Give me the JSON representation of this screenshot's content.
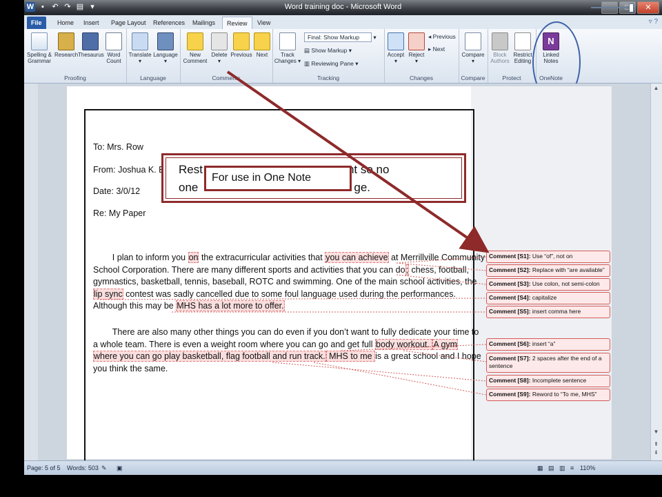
{
  "window": {
    "title": "Word training doc - Microsoft Word",
    "qat_icons": [
      "word-logo-icon",
      "save-icon",
      "undo-icon",
      "redo-icon",
      "print-preview-icon",
      "customize-qat-icon"
    ],
    "controls": [
      "minimize-icon",
      "maximize-icon",
      "close-icon"
    ]
  },
  "tabs": [
    {
      "label": "File"
    },
    {
      "label": "Home"
    },
    {
      "label": "Insert"
    },
    {
      "label": "Page Layout"
    },
    {
      "label": "References"
    },
    {
      "label": "Mailings"
    },
    {
      "label": "Review"
    },
    {
      "label": "View"
    }
  ],
  "ribbon": {
    "proofing": {
      "name": "Proofing",
      "spelling": "Spelling & Grammar",
      "spelling_l1": "Spelling &",
      "spelling_l2": "Grammar",
      "research": "Research",
      "thesaurus": "Thesaurus",
      "wordcount_l1": "Word",
      "wordcount_l2": "Count"
    },
    "language": {
      "name": "Language",
      "translate": "Translate",
      "language": "Language"
    },
    "comments": {
      "name": "Comments",
      "new_l1": "New",
      "new_l2": "Comment",
      "delete": "Delete",
      "previous": "Previous",
      "next": "Next"
    },
    "tracking": {
      "name": "Tracking",
      "track_l1": "Track",
      "track_l2": "Changes",
      "final_markup": "Final: Show Markup",
      "show_markup": "Show Markup",
      "reviewing_pane": "Reviewing Pane"
    },
    "changes": {
      "name": "Changes",
      "accept": "Accept",
      "reject": "Reject",
      "previous": "Previous",
      "next": "Next"
    },
    "compare": {
      "name": "Compare",
      "compare": "Compare"
    },
    "protect": {
      "name": "Protect",
      "block_l1": "Block",
      "block_l2": "Authors",
      "restrict_l1": "Restrict",
      "restrict_l2": "Editing"
    },
    "onenote": {
      "name": "OneNote",
      "linked_l1": "Linked",
      "linked_l2": "Notes"
    }
  },
  "document": {
    "to": "To:  Mrs. Row",
    "from": "From:  Joshua K. Brewer",
    "date": "Date:  3/0/12",
    "re": "Re:  My Paper",
    "p1": {
      "l1_a": "I plan to inform you ",
      "l1_b": "on",
      "l1_c": " the extracurricular activities that ",
      "l1_d": "you can achieve",
      "l1_e": " at Merrillville Community",
      "l2_a": "School Corporation.  There are many different sports and activities that you can do",
      "l2_b": ";",
      "l2_c": " chess, football,",
      "l3": "gymnastics, basketball, tennis, baseball, ROTC and swimming.  One of the main school activities, the",
      "l4_a": "lip sync",
      "l4_b": " contest was sadly cancelled due to some foul language used during the performances.",
      "l5_a": "Although this may be ",
      "l5_b": "MHS has a lot more to offer."
    },
    "p2": {
      "l1": "There are also many other things you can do even if you don’t want to fully dedicate your time to",
      "l2_a": "a whole team.  There is even a weight room where you can go and get full ",
      "l2_b": "body workout. ",
      "l2_c": "A gym",
      "l3_a": "where you can go play basketball, flag football and run track.",
      "l3_b": " MHS to me ",
      "l3_c": "is a great school and I hope",
      "l4": "you think the same."
    }
  },
  "comments": [
    {
      "label": "Comment [S1]:",
      "text": " Use “of”, not on"
    },
    {
      "label": "Comment [S2]:",
      "text": " Replace with “are available”"
    },
    {
      "label": "Comment [S3]:",
      "text": " Use colon, not semi-colon"
    },
    {
      "label": "Comment [S4]:",
      "text": " capitalize"
    },
    {
      "label": "Comment [S5]:",
      "text": " insert comma here"
    },
    {
      "label": "Comment [S6]:",
      "text": " insert “a”"
    },
    {
      "label": "Comment [S7]:",
      "text": " 2 spaces after the end of a sentence"
    },
    {
      "label": "Comment [S8]:",
      "text": " Incomplete sentence"
    },
    {
      "label": "Comment [S9]:",
      "text": " Reword to “To me, MHS”"
    }
  ],
  "overlay": {
    "restrict_text": "Restrict editing to a document so no one else can make a change.",
    "restrict_visible_a": "Rest",
    "restrict_visible_b": "nt so no",
    "restrict_visible_c": "one",
    "restrict_visible_d": "ge.",
    "callout": "For use in One Note",
    "arrow_color": "#8e2a2a",
    "circle_color": "#3d62a8"
  },
  "statusbar": {
    "page": "Page: 5 of 5",
    "words": "Words: 503",
    "zoom": "110%"
  }
}
